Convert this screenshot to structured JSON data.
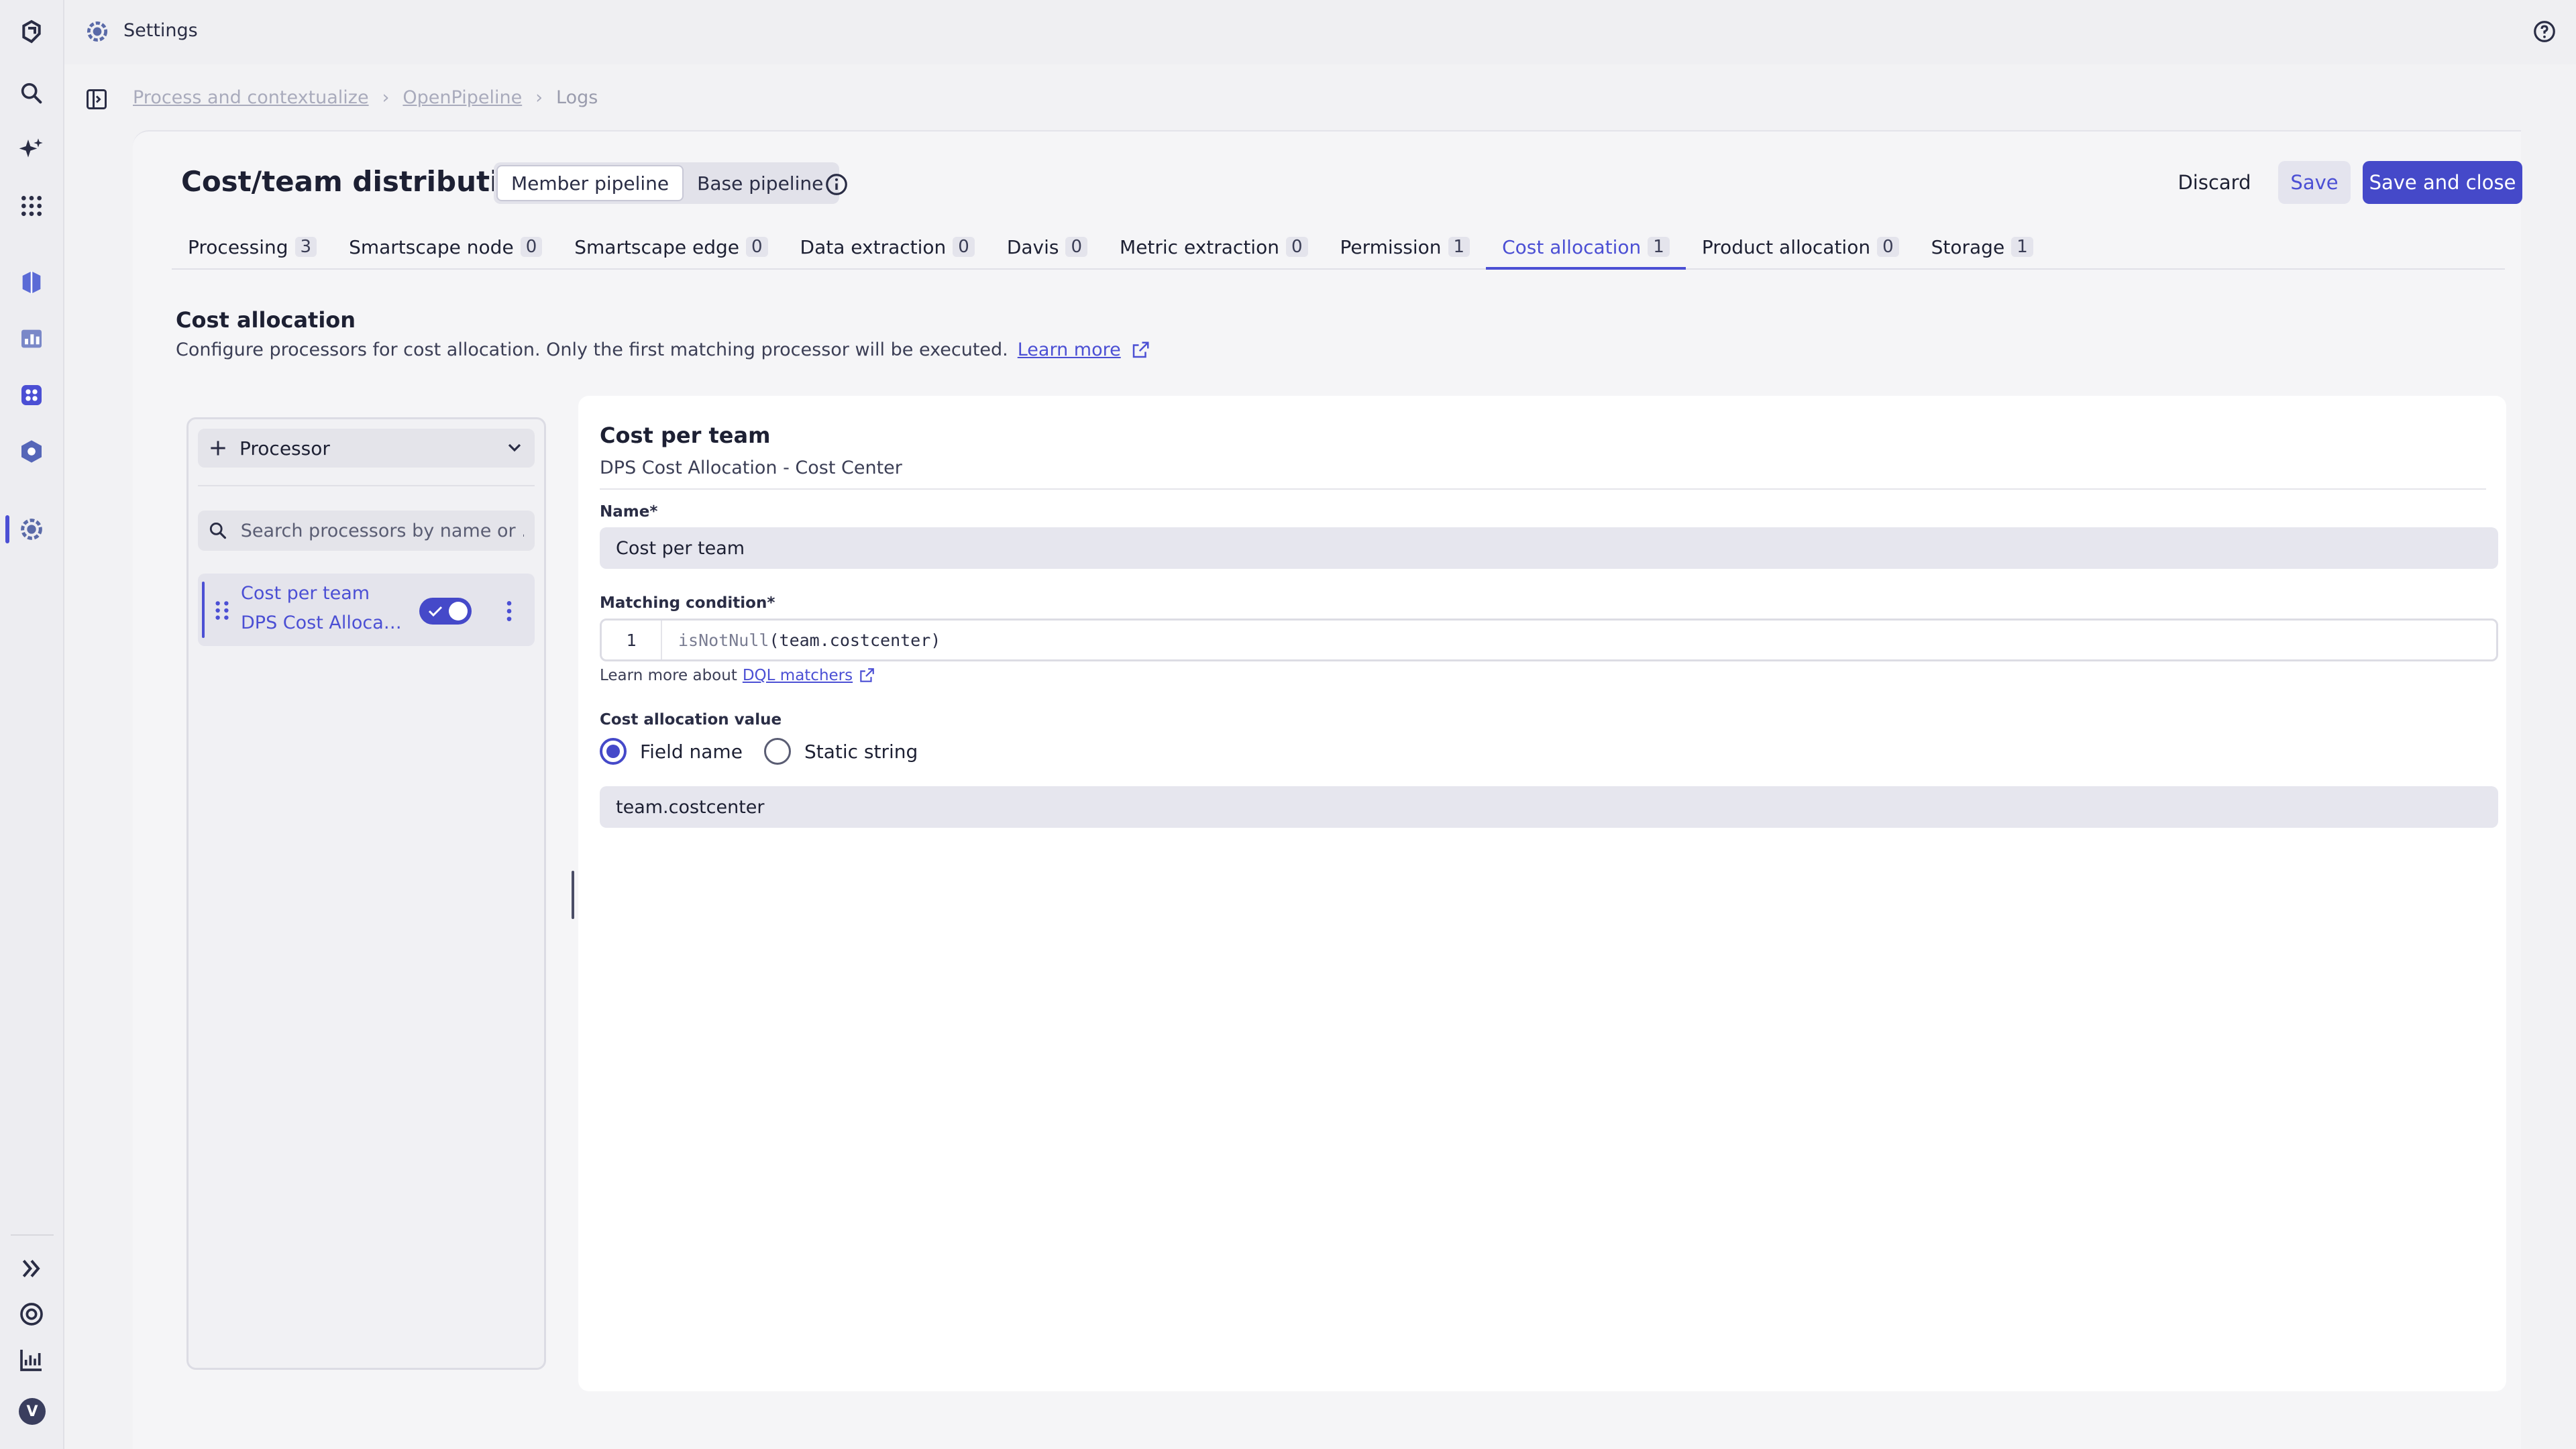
{
  "topbar": {
    "title": "Settings"
  },
  "breadcrumb": [
    "Process and contextualize",
    "OpenPipeline",
    "Logs"
  ],
  "header": {
    "title": "Cost/team distribution",
    "pipeline_toggle": [
      "Member pipeline",
      "Base pipeline"
    ],
    "active_pipeline": "Member pipeline",
    "discard_label": "Discard",
    "save_label": "Save",
    "save_close_label": "Save and close"
  },
  "tabs": [
    {
      "label": "Processing",
      "count": "3"
    },
    {
      "label": "Smartscape node",
      "count": "0"
    },
    {
      "label": "Smartscape edge",
      "count": "0"
    },
    {
      "label": "Data extraction",
      "count": "0"
    },
    {
      "label": "Davis",
      "count": "0"
    },
    {
      "label": "Metric extraction",
      "count": "0"
    },
    {
      "label": "Permission",
      "count": "1"
    },
    {
      "label": "Cost allocation",
      "count": "1"
    },
    {
      "label": "Product allocation",
      "count": "0"
    },
    {
      "label": "Storage",
      "count": "1"
    }
  ],
  "active_tab": "Cost allocation",
  "section": {
    "title": "Cost allocation",
    "description": "Configure processors for cost allocation. Only the first matching processor will be executed.",
    "learn_more": "Learn more"
  },
  "processor_list": {
    "add_label": "Processor",
    "search_placeholder": "Search processors by name or ...",
    "items": [
      {
        "name": "Cost per team",
        "type": "DPS Cost Allocation - Cost Center",
        "enabled": true
      }
    ]
  },
  "editor": {
    "title": "Cost per team",
    "subtitle": "DPS Cost Allocation - Cost Center",
    "name_label": "Name*",
    "name_value": "Cost per team",
    "matching_label": "Matching condition*",
    "line_number": "1",
    "code_fn": "isNotNull",
    "code_args": "(team.costcenter)",
    "learn_more_prefix": "Learn more about",
    "learn_more_link": "DQL matchers",
    "value_label": "Cost allocation value",
    "radio_field_name": "Field name",
    "radio_static_string": "Static string",
    "selected_radio": "Field name",
    "field_value": "team.costcenter"
  },
  "user": {
    "avatar_letter": "V"
  },
  "colors": {
    "accent": "#4b4fd4",
    "primary_button": "#4549c9"
  }
}
